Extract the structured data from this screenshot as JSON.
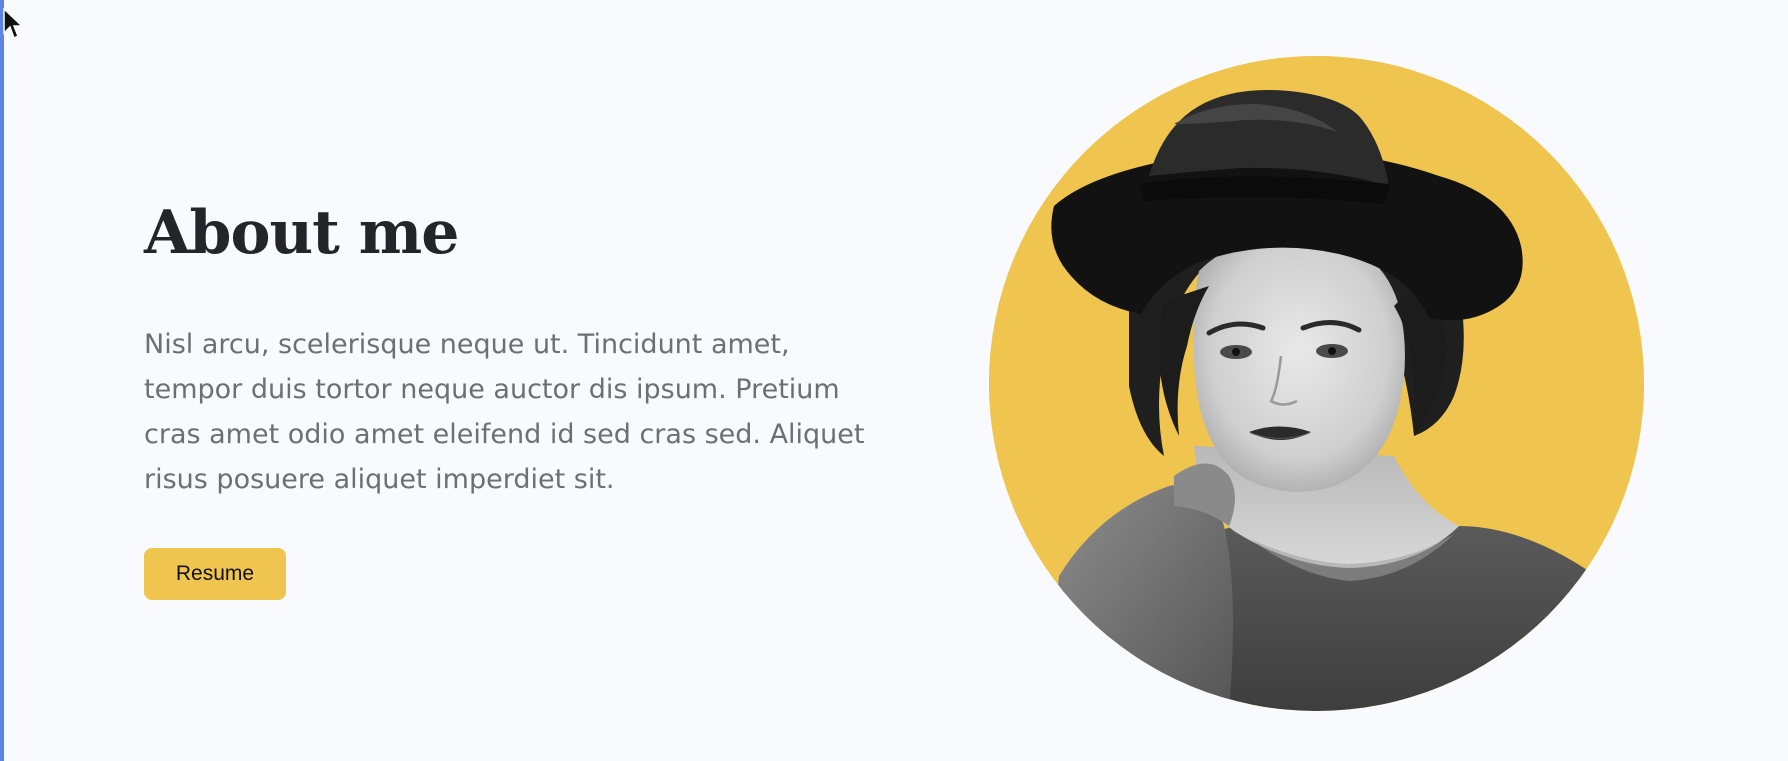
{
  "about": {
    "heading": "About me",
    "description": "Nisl arcu, scelerisque neque ut. Tincidunt amet, tempor duis tortor neque auctor dis ipsum. Pretium cras amet odio amet eleifend id sed cras sed. Aliquet risus posuere aliquet imperdiet sit.",
    "button_label": "Resume"
  },
  "colors": {
    "background": "#f9fafd",
    "accent": "#efc54f",
    "heading": "#23252b",
    "body_text": "#6d6f75",
    "left_edge": "#5b86e6"
  },
  "icons": {
    "cursor": "mouse-pointer-icon"
  }
}
